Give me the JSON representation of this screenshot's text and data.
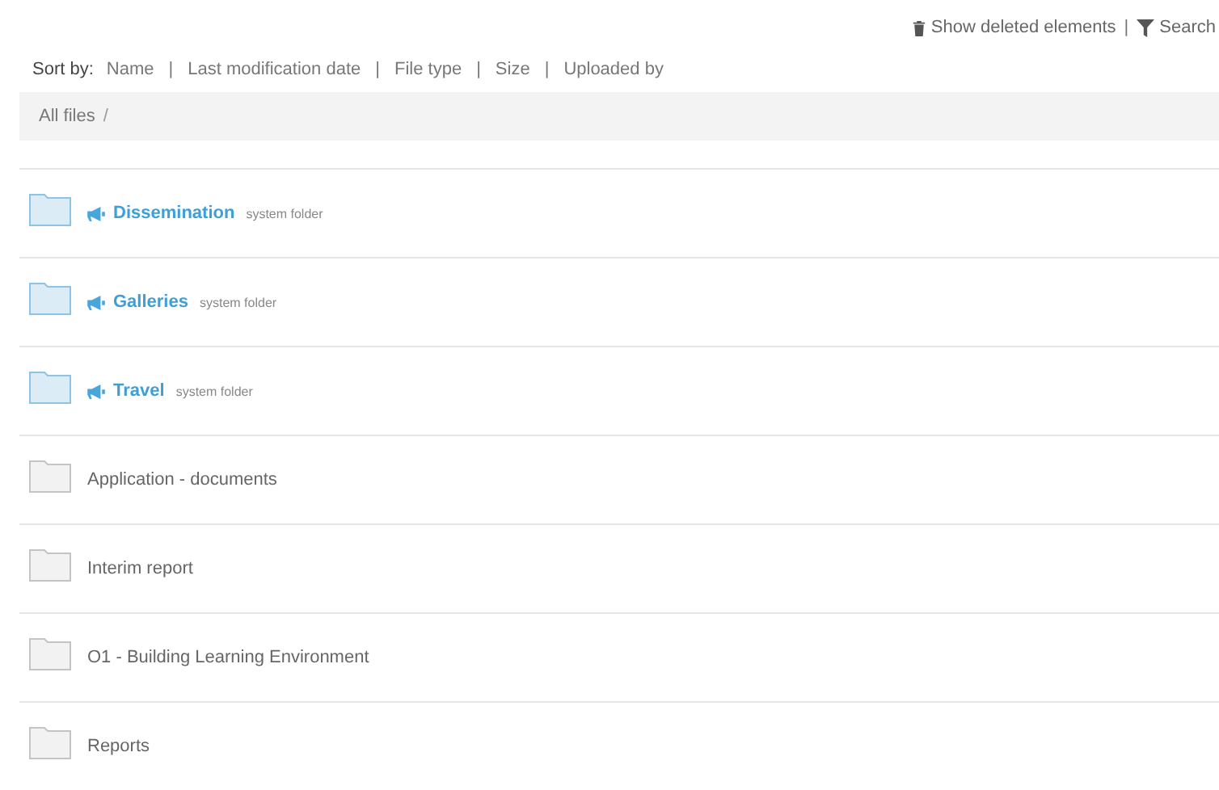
{
  "actions": {
    "show_deleted": "Show deleted elements",
    "separator": "|",
    "search": "Search"
  },
  "sort_by": {
    "label": "Sort by:",
    "separator": "|",
    "options": [
      "Name",
      "Last modification date",
      "File type",
      "Size",
      "Uploaded by"
    ]
  },
  "breadcrumb": {
    "items": [
      "All files"
    ],
    "separator": "/"
  },
  "folders": [
    {
      "kind": "system",
      "name": "Dissemination",
      "note": "system folder"
    },
    {
      "kind": "system",
      "name": "Galleries",
      "note": "system folder"
    },
    {
      "kind": "system",
      "name": "Travel",
      "note": "system folder"
    },
    {
      "kind": "regular",
      "name": "Application - documents"
    },
    {
      "kind": "regular",
      "name": "Interim report"
    },
    {
      "kind": "regular",
      "name": "O1 - Building Learning Environment"
    },
    {
      "kind": "regular",
      "name": "Reports"
    }
  ]
}
